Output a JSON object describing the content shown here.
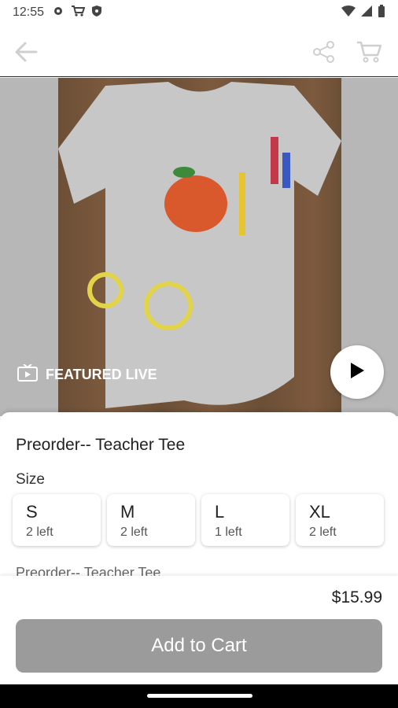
{
  "status": {
    "time": "12:55"
  },
  "icons": {
    "settings": "gear-icon",
    "shopping": "cart-icon",
    "shield": "shield-icon",
    "wifi": "wifi-icon",
    "signal": "signal-icon",
    "battery": "battery-icon",
    "back": "arrow-left-icon",
    "share": "share-icon",
    "cart": "cart-icon",
    "tv": "tv-icon",
    "play": "play-icon"
  },
  "media": {
    "featured_label": "FEATURED LIVE"
  },
  "product": {
    "title": "Preorder-- Teacher Tee",
    "size_label": "Size",
    "sizes": [
      {
        "name": "S",
        "stock": "2 left"
      },
      {
        "name": "M",
        "stock": "2 left"
      },
      {
        "name": "L",
        "stock": "1 left"
      },
      {
        "name": "XL",
        "stock": "2 left"
      }
    ],
    "description": "Preorder-- Teacher Tee.",
    "price": "$15.99",
    "add_to_cart_label": "Add to Cart"
  },
  "colors": {
    "accent_disabled": "#9b9b9b",
    "text": "#222222"
  }
}
